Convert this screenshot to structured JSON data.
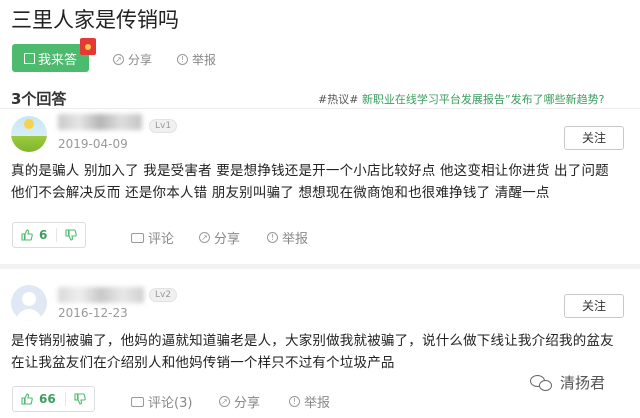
{
  "question": {
    "title": "三里人家是传销吗"
  },
  "toolbar": {
    "answer_label": "我来答",
    "share_label": "分享",
    "report_label": "举报"
  },
  "answers_header": {
    "count_label": "3个回答",
    "hot_tag": "#热议#",
    "hot_link": "新职业在线学习平台发展报告”发布了哪些新趋势?"
  },
  "answers": [
    {
      "level": "Lv1",
      "date": "2019-04-09",
      "follow_label": "关注",
      "text": "真的是骗人 别加入了 我是受害者 要是想挣钱还是开一个小店比较好点 他这变相让你进货 出了问题 他们不会解决反而 还是你本人错 朋友别叫骗了 想想现在微商饱和也很难挣钱了 清醒一点",
      "likes": "6",
      "comment_label": "评论",
      "share_label": "分享",
      "report_label": "举报"
    },
    {
      "level": "Lv2",
      "date": "2016-12-23",
      "follow_label": "关注",
      "text": "是传销别被骗了，他妈的逼就知道骗老是人，大家别做我就被骗了，说什么做下线让我介绍我的盆友在让我盆友们在介绍别人和他妈传销一个样只不过有个垃圾产品",
      "likes": "66",
      "comment_label": "评论(3)",
      "share_label": "分享",
      "report_label": "举报"
    }
  ],
  "watermark": {
    "text": "清扬君"
  },
  "colors": {
    "accent_green": "#4dbb6d",
    "link_green": "#3a9d5d"
  }
}
